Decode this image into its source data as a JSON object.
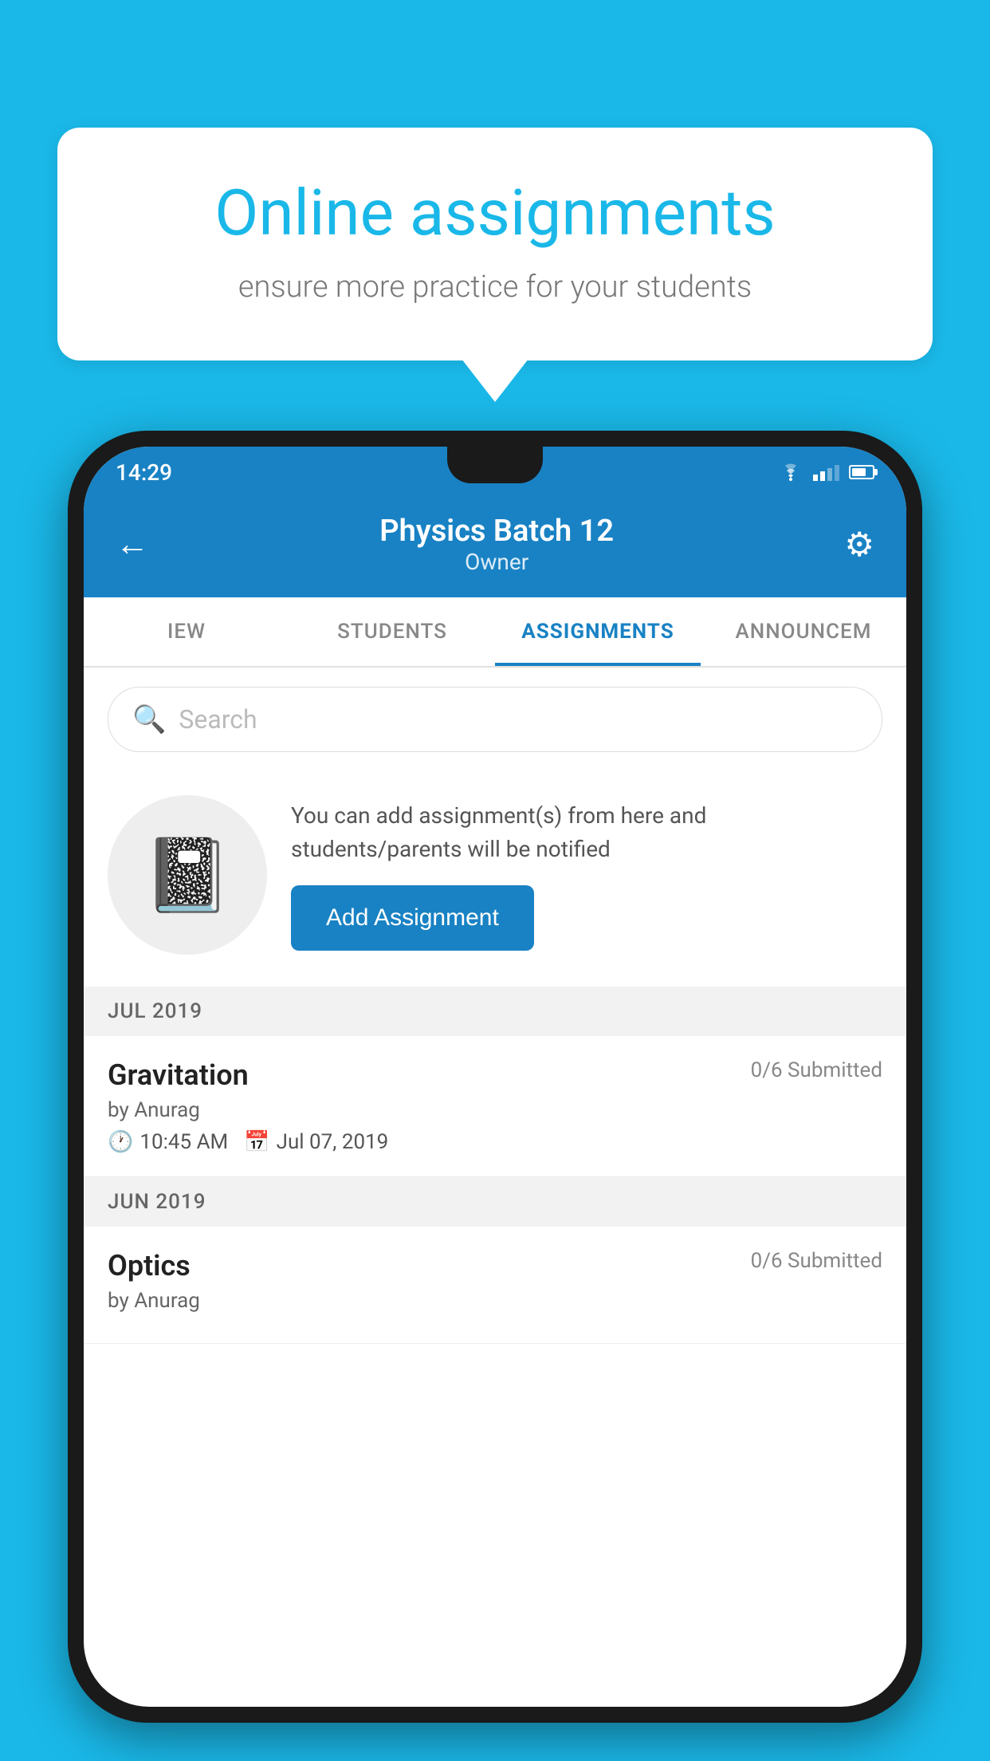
{
  "background_color": "#1ab8e8",
  "speech_bubble": {
    "title": "Online assignments",
    "subtitle": "ensure more practice for your students"
  },
  "phone": {
    "status_bar": {
      "time": "14:29"
    },
    "header": {
      "title": "Physics Batch 12",
      "subtitle": "Owner",
      "back_label": "←",
      "gear_label": "⚙"
    },
    "tabs": [
      {
        "label": "IEW",
        "active": false
      },
      {
        "label": "STUDENTS",
        "active": false
      },
      {
        "label": "ASSIGNMENTS",
        "active": true
      },
      {
        "label": "ANNOUNCEM",
        "active": false
      }
    ],
    "search": {
      "placeholder": "Search"
    },
    "info_card": {
      "description": "You can add assignment(s) from here and students/parents will be notified",
      "button_label": "Add Assignment"
    },
    "sections": [
      {
        "label": "JUL 2019",
        "assignments": [
          {
            "name": "Gravitation",
            "submitted": "0/6 Submitted",
            "by": "by Anurag",
            "time": "10:45 AM",
            "date": "Jul 07, 2019"
          }
        ]
      },
      {
        "label": "JUN 2019",
        "assignments": [
          {
            "name": "Optics",
            "submitted": "0/6 Submitted",
            "by": "by Anurag",
            "time": "",
            "date": ""
          }
        ]
      }
    ]
  }
}
